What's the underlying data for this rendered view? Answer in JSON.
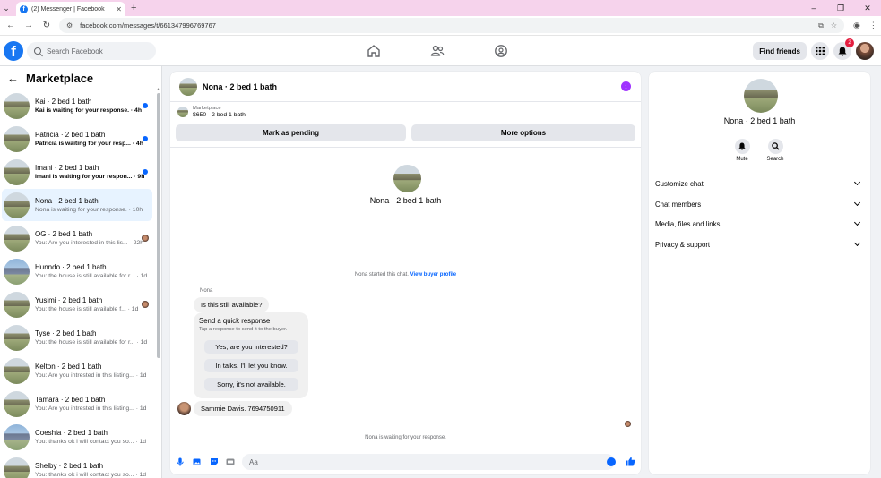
{
  "browser": {
    "tab_title": "(2) Messenger | Facebook",
    "url": "facebook.com/messages/t/661347996769767"
  },
  "topbar": {
    "search_placeholder": "Search Facebook",
    "find_friends": "Find friends",
    "notifications_badge": "2"
  },
  "sidebar": {
    "title": "Marketplace",
    "conversations": [
      {
        "name": "Kai · 2 bed 1 bath",
        "preview": "Kai is waiting for your response. · 4h",
        "unread": true,
        "thumb": "house"
      },
      {
        "name": "Patricia · 2 bed 1 bath",
        "preview": "Patricia is waiting for your resp... · 4h",
        "unread": true,
        "thumb": "house"
      },
      {
        "name": "Imani · 2 bed 1 bath",
        "preview": "Imani is waiting for your respon... · 9h",
        "unread": true,
        "thumb": "house"
      },
      {
        "name": "Nona · 2 bed 1 bath",
        "preview": "Nona is waiting for your response. · 10h",
        "unread": false,
        "active": true,
        "thumb": "house"
      },
      {
        "name": "OG · 2 bed 1 bath",
        "preview": "You: Are you interested in this lis... · 22h",
        "unread": false,
        "seen": true,
        "thumb": "house"
      },
      {
        "name": "Hunndo · 2 bed 1 bath",
        "preview": "You: the house is still available for r... · 1d",
        "unread": false,
        "thumb": "blue"
      },
      {
        "name": "Yusimi · 2 bed 1 bath",
        "preview": "You: the house is still available f... · 1d",
        "unread": false,
        "seen": true,
        "thumb": "house"
      },
      {
        "name": "Tyse · 2 bed 1 bath",
        "preview": "You: the house is still available for r... · 1d",
        "unread": false,
        "thumb": "house"
      },
      {
        "name": "Kelton · 2 bed 1 bath",
        "preview": "You: Are you intrested in this listing... · 1d",
        "unread": false,
        "thumb": "house"
      },
      {
        "name": "Tamara · 2 bed 1 bath",
        "preview": "You: Are you intrested in this listing... · 1d",
        "unread": false,
        "thumb": "house"
      },
      {
        "name": "Coeshia · 2 bed 1 bath",
        "preview": "You: thanks ok i will contact you so... · 1d",
        "unread": false,
        "thumb": "blue"
      },
      {
        "name": "Shelby · 2 bed 1 bath",
        "preview": "You: thanks ok i will contact you so... · 1d",
        "unread": false,
        "thumb": "house"
      }
    ]
  },
  "chat": {
    "title": "Nona · 2 bed 1 bath",
    "marketplace_label": "Marketplace",
    "listing": "$650 · 2 bed 1 bath",
    "mark_pending": "Mark as pending",
    "more_options": "More options",
    "center_name": "Nona · 2 bed 1 bath",
    "started_text": "Nona started this chat.",
    "view_profile": "View buyer profile",
    "sender": "Nona",
    "message1": "Is this still available?",
    "quick_title": "Send a quick response",
    "quick_sub": "Tap a response to send it to the buyer.",
    "quick_options": [
      "Yes, are you interested?",
      "In talks. I'll let you know.",
      "Sorry, it's not available."
    ],
    "message2": "Sammie Davis. 7694750911",
    "waiting_text": "Nona is waiting for your response.",
    "input_placeholder": "Aa"
  },
  "details": {
    "name": "Nona · 2 bed 1 bath",
    "mute": "Mute",
    "search": "Search",
    "sections": [
      "Customize chat",
      "Chat members",
      "Media, files and links",
      "Privacy & support"
    ]
  },
  "colors": {
    "brand": "#1877f2",
    "unread_dot": "#0866ff",
    "info": "#a033ff",
    "badge": "#e41e3f"
  }
}
